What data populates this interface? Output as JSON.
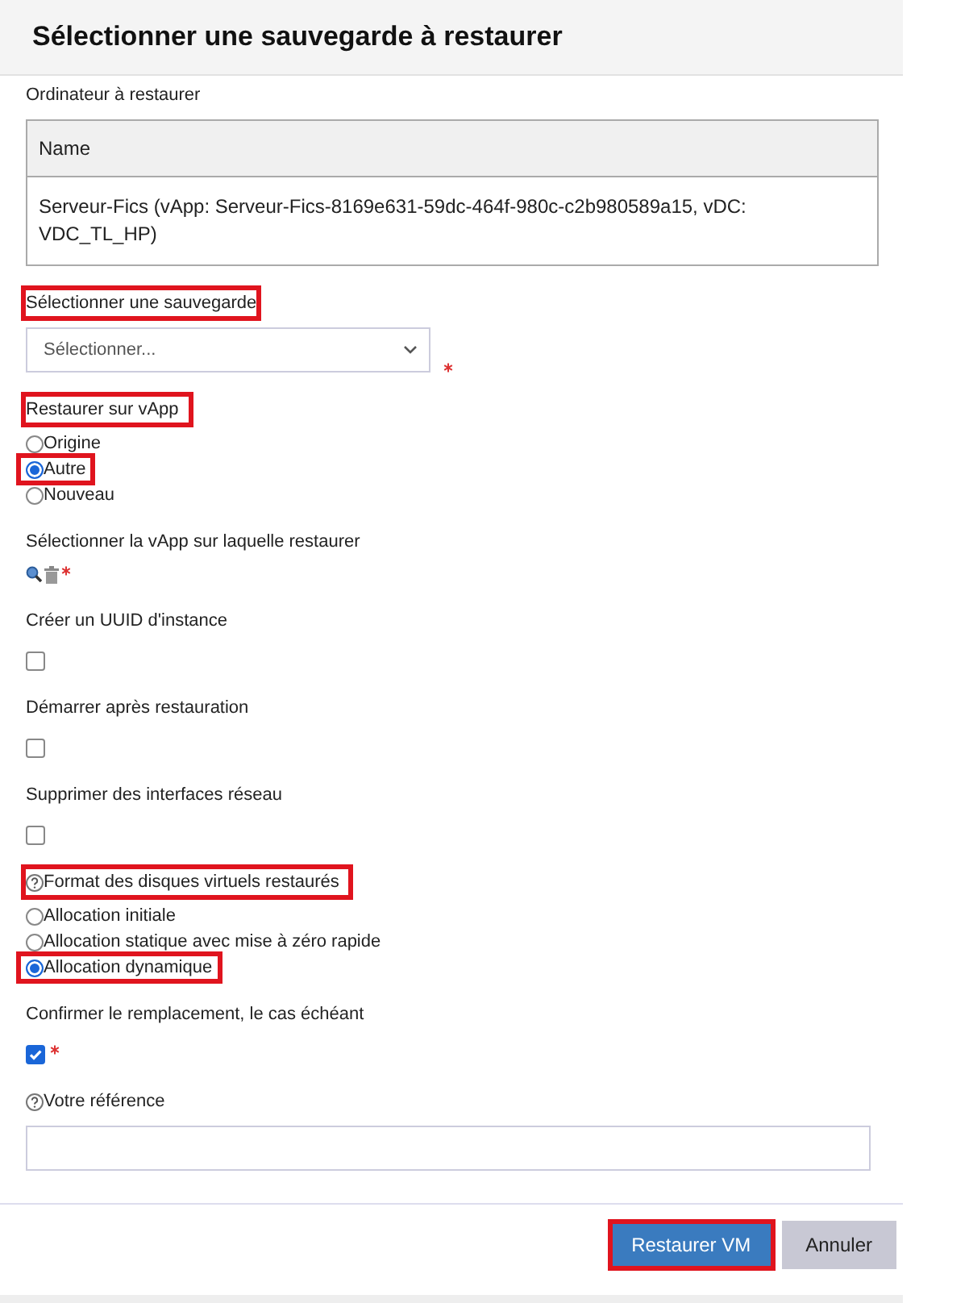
{
  "dialog": {
    "title": "Sélectionner une sauvegarde à restaurer"
  },
  "fields": [
    {
      "kind": "table",
      "label": "Ordinateur à restaurer",
      "columns": [
        "Name"
      ],
      "rows": [
        [
          "Serveur-Fics (vApp: Serveur-Fics-8169e631-59dc-464f-980c-c2b980589a15, vDC: VDC_TL_HP)"
        ]
      ]
    },
    {
      "kind": "select",
      "label": "Sélectionner une sauvegarde",
      "highlighted": true,
      "placeholder": "Sélectionner...",
      "required": true
    },
    {
      "kind": "radios",
      "label": "Restaurer sur vApp",
      "highlighted": true,
      "options": [
        {
          "label": "Origine",
          "selected": false,
          "highlighted": false
        },
        {
          "label": "Autre",
          "selected": true,
          "highlighted": true
        },
        {
          "label": "Nouveau",
          "selected": false,
          "highlighted": false
        }
      ]
    },
    {
      "kind": "picker",
      "label": "Sélectionner la vApp sur laquelle restaurer",
      "required": true
    },
    {
      "kind": "checkbox",
      "label": "Créer un UUID d'instance",
      "checked": false
    },
    {
      "kind": "checkbox",
      "label": "Démarrer après restauration",
      "checked": false
    },
    {
      "kind": "checkbox",
      "label": "Supprimer des interfaces réseau",
      "checked": false
    },
    {
      "kind": "radios",
      "label": "Format des disques virtuels restaurés",
      "highlighted": true,
      "help": true,
      "options": [
        {
          "label": "Allocation initiale",
          "selected": false,
          "highlighted": false
        },
        {
          "label": "Allocation statique avec mise à zéro rapide",
          "selected": false,
          "highlighted": false
        },
        {
          "label": "Allocation dynamique",
          "selected": true,
          "highlighted": true
        }
      ]
    },
    {
      "kind": "checkbox",
      "label": "Confirmer le remplacement, le cas échéant",
      "checked": true,
      "required": true
    },
    {
      "kind": "text",
      "label": "Votre référence",
      "help": true
    }
  ],
  "buttons": [
    {
      "label": "Restaurer VM",
      "kind": "primary",
      "highlighted": true
    },
    {
      "label": "Annuler",
      "kind": "secondary",
      "highlighted": false
    }
  ]
}
